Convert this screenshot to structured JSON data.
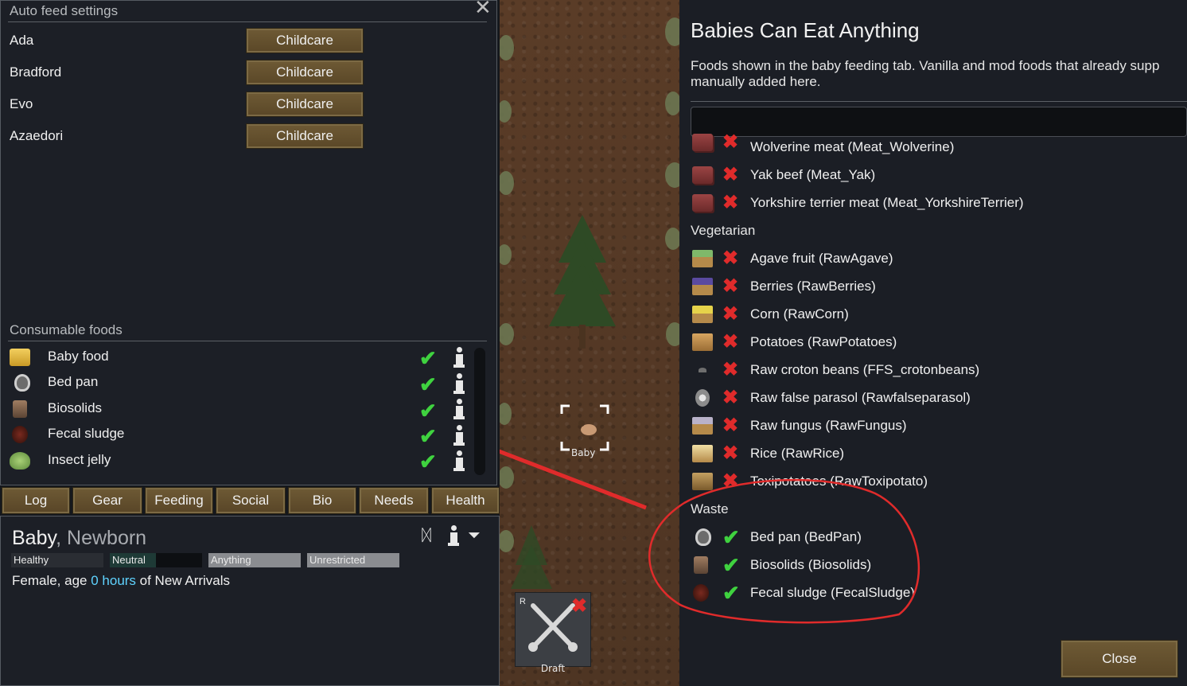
{
  "autofeed": {
    "title": "Auto feed settings",
    "pawns": [
      {
        "name": "Ada",
        "mode": "Childcare"
      },
      {
        "name": "Bradford",
        "mode": "Childcare"
      },
      {
        "name": "Evo",
        "mode": "Childcare"
      },
      {
        "name": "Azaedori",
        "mode": "Childcare"
      }
    ],
    "consumable_title": "Consumable foods",
    "foods": [
      {
        "label": "Baby food",
        "icon": "baby-food-icon"
      },
      {
        "label": "Bed pan",
        "icon": "bed-pan-icon"
      },
      {
        "label": "Biosolids",
        "icon": "biosolids-icon"
      },
      {
        "label": "Fecal sludge",
        "icon": "fecal-sludge-icon"
      },
      {
        "label": "Insect jelly",
        "icon": "insect-jelly-icon"
      }
    ]
  },
  "tabs": [
    "Log",
    "Gear",
    "Feeding",
    "Social",
    "Bio",
    "Needs",
    "Health"
  ],
  "inspect": {
    "name": "Baby",
    "title_suffix": ", Newborn",
    "tags": [
      "Healthy",
      "Neutral",
      "Anything",
      "Unrestricted"
    ],
    "desc_prefix": "Female, age ",
    "age_value": "0 hours",
    "desc_suffix": " of New Arrivals"
  },
  "map": {
    "baby_label": "Baby",
    "draft_label": "Draft",
    "draft_hotkey": "R"
  },
  "dialog": {
    "title": "Babies Can Eat Anything",
    "description": "Foods shown in the baby feeding tab. Vanilla and mod foods that already supp manually added here.",
    "search_value": "",
    "rows_top": [
      {
        "label": "Wolverine meat (Meat_Wolverine)"
      },
      {
        "label": "Yak beef (Meat_Yak)"
      },
      {
        "label": "Yorkshire terrier meat (Meat_YorkshireTerrier)"
      }
    ],
    "vegetarian_title": "Vegetarian",
    "vegetarian": [
      {
        "label": "Agave fruit (RawAgave)"
      },
      {
        "label": "Berries (RawBerries)"
      },
      {
        "label": "Corn (RawCorn)"
      },
      {
        "label": "Potatoes (RawPotatoes)"
      },
      {
        "label": "Raw croton beans (FFS_crotonbeans)"
      },
      {
        "label": "Raw false parasol (Rawfalseparasol)"
      },
      {
        "label": "Raw fungus (RawFungus)"
      },
      {
        "label": "Rice (RawRice)"
      },
      {
        "label": "Toxipotatoes (RawToxipotato)"
      }
    ],
    "waste_title": "Waste",
    "waste": [
      {
        "label": "Bed pan (BedPan)"
      },
      {
        "label": "Biosolids (Biosolids)"
      },
      {
        "label": "Fecal sludge (FecalSludge)"
      }
    ],
    "close_label": "Close"
  },
  "colors": {
    "accent_red": "#e02b2b",
    "check_green": "#3fd23f",
    "age_highlight": "#5fd3ff"
  }
}
